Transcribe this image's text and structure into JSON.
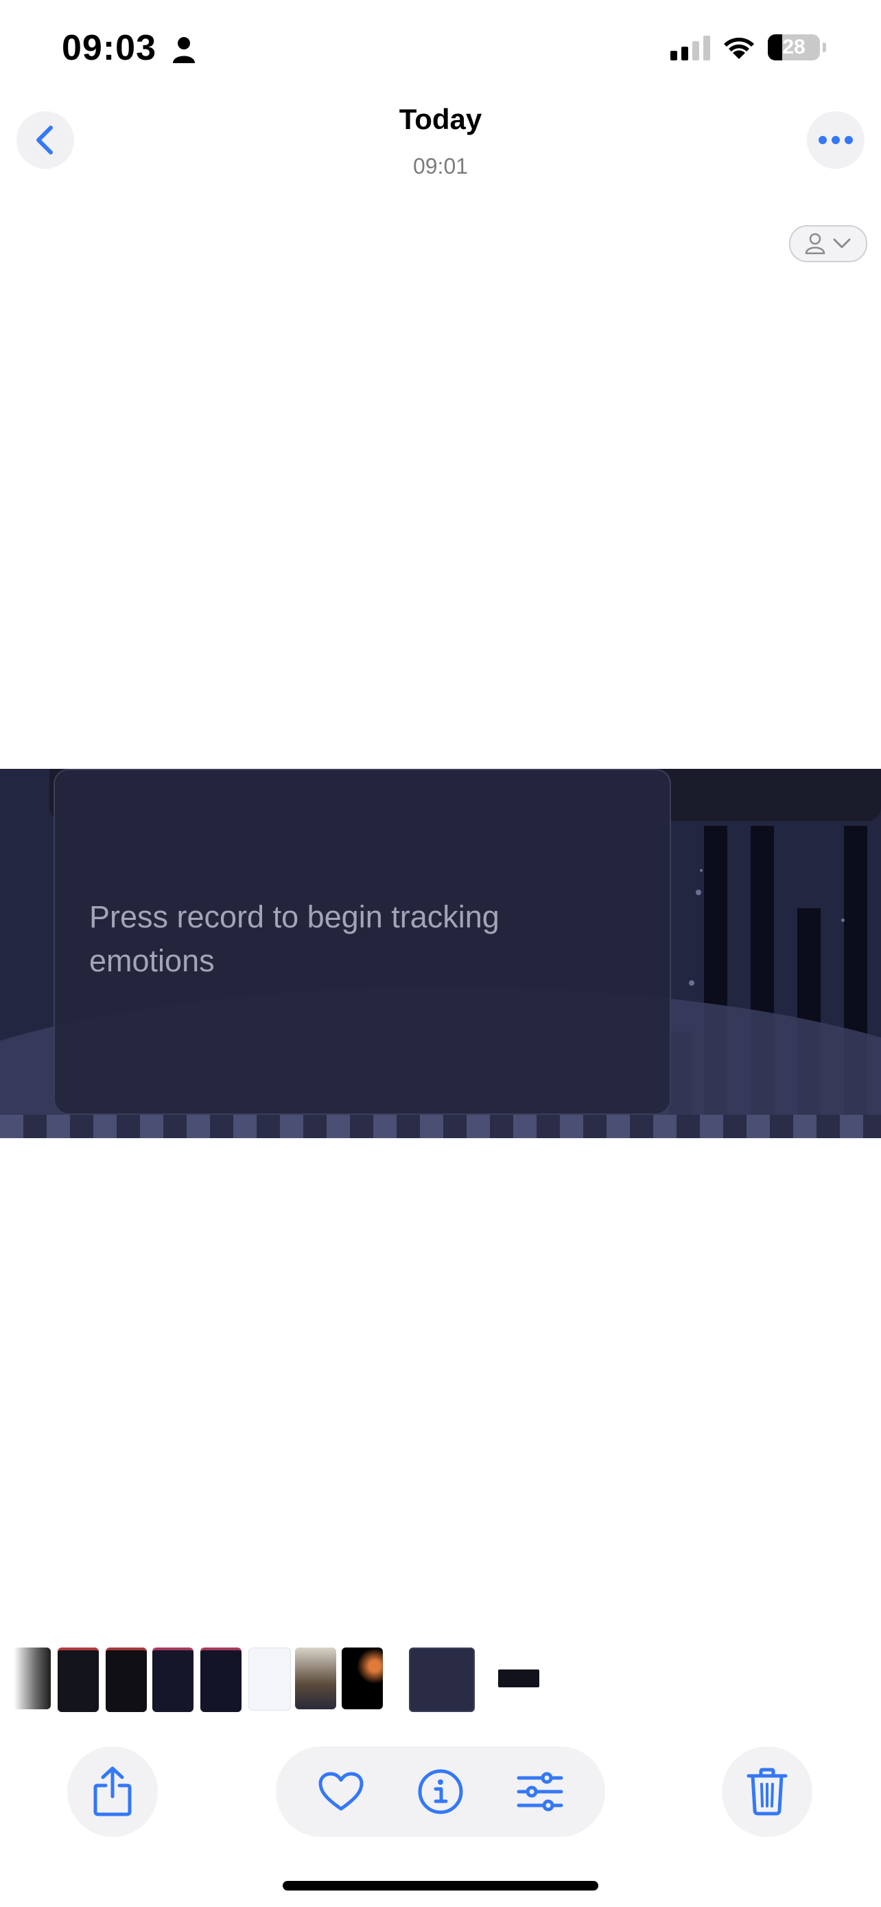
{
  "status_bar": {
    "time": "09:03",
    "battery": "28",
    "battery_level": 0.28
  },
  "header": {
    "title": "Today",
    "subtitle": "09:01"
  },
  "photo": {
    "prompt_text": "Press record to begin tracking emotions"
  },
  "icons": {
    "back": "chevron-left-icon",
    "more": "ellipsis-icon",
    "person": "person-icon",
    "share": "share-icon",
    "favorite": "heart-icon",
    "info": "info-icon",
    "adjust": "sliders-icon",
    "delete": "trash-icon"
  },
  "colors": {
    "accent": "#3478f6",
    "background": "#ffffff",
    "photo_background": "#232640"
  }
}
